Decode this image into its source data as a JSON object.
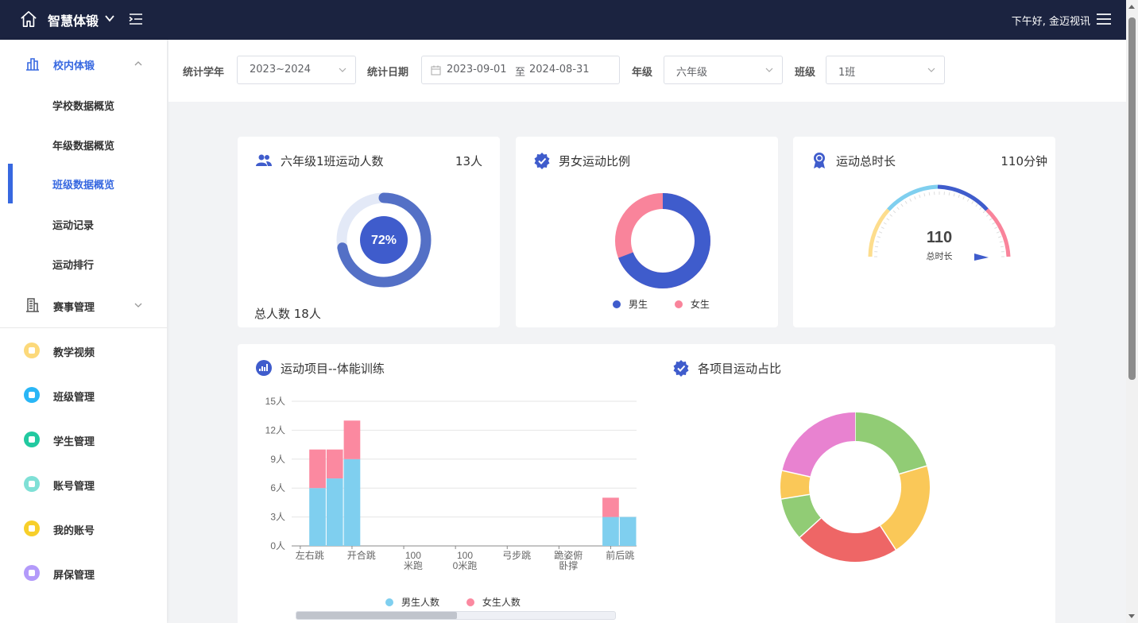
{
  "header": {
    "brand": "智慧体锻",
    "greeting": "下午好, 金迈视讯"
  },
  "sidebar": {
    "group_campus": "校内体锻",
    "sub_items": [
      "学校数据概览",
      "年级数据概览",
      "班级数据概览",
      "运动记录",
      "运动排行"
    ],
    "group_events": "赛事管理",
    "items": [
      {
        "label": "教学视频",
        "color": "#fcd97a"
      },
      {
        "label": "班级管理",
        "color": "#29b6f6"
      },
      {
        "label": "学生管理",
        "color": "#22c9a0"
      },
      {
        "label": "账号管理",
        "color": "#7fe0d6"
      },
      {
        "label": "我的账号",
        "color": "#f7cf2a"
      },
      {
        "label": "屏保管理",
        "color": "#b39afa"
      }
    ]
  },
  "filters": {
    "year_label": "统计学年",
    "year_value": "2023~2024",
    "date_label": "统计日期",
    "date_start": "2023-09-01",
    "date_sep": "至",
    "date_end": "2024-08-31",
    "grade_label": "年级",
    "grade_value": "六年级",
    "class_label": "班级",
    "class_value": "1班"
  },
  "card_participants": {
    "title": "六年级1班运动人数",
    "value": "13人",
    "percent": "72%",
    "ratio": 0.72,
    "total": "总人数 18人"
  },
  "card_gender": {
    "title": "男女运动比例",
    "legend_male": "男生",
    "legend_female": "女生",
    "male_ratio": 0.69
  },
  "card_duration": {
    "title": "运动总时长",
    "value": "110分钟",
    "gauge_value": "110",
    "gauge_label": "总时长"
  },
  "card_projects": {
    "title": "运动项目--体能训练",
    "legend_male": "男生人数",
    "legend_female": "女生人数"
  },
  "card_share": {
    "title": "各项目运动占比"
  },
  "colors": {
    "primary": "#3768e0",
    "male": "#3f5ccc",
    "female": "#f9849b",
    "bar_male": "#7fcfef",
    "bar_female": "#fb89a0"
  },
  "chart_data": [
    {
      "type": "bar",
      "title": "运动项目--体能训练",
      "ylim": [
        0,
        15
      ],
      "yticks": [
        "0人",
        "3人",
        "6人",
        "9人",
        "12人",
        "15人"
      ],
      "x_tick_labels": [
        "左右跳",
        "开合跳",
        "100米跑",
        "1000米跑",
        "弓步跳",
        "跪姿俯卧撑",
        "前后跳"
      ],
      "stacked": true,
      "series": [
        {
          "name": "男生人数",
          "values": [
            0,
            6,
            7,
            9,
            0,
            0,
            0,
            0,
            0,
            0,
            0,
            0,
            0,
            0,
            0,
            0,
            0,
            0,
            3,
            3
          ]
        },
        {
          "name": "女生人数",
          "values": [
            0,
            4,
            3,
            4,
            0,
            0,
            0,
            0,
            0,
            0,
            0,
            0,
            0,
            0,
            0,
            0,
            0,
            0,
            2,
            0
          ]
        }
      ],
      "legend": "bottom",
      "grid": true
    },
    {
      "type": "pie",
      "title": "各项目运动占比",
      "values": [
        20,
        20,
        22,
        9,
        6,
        21
      ],
      "colors": [
        "#91cc75",
        "#fac858",
        "#ee6666",
        "#91cc75",
        "#fac858",
        "#e882d0"
      ]
    }
  ]
}
